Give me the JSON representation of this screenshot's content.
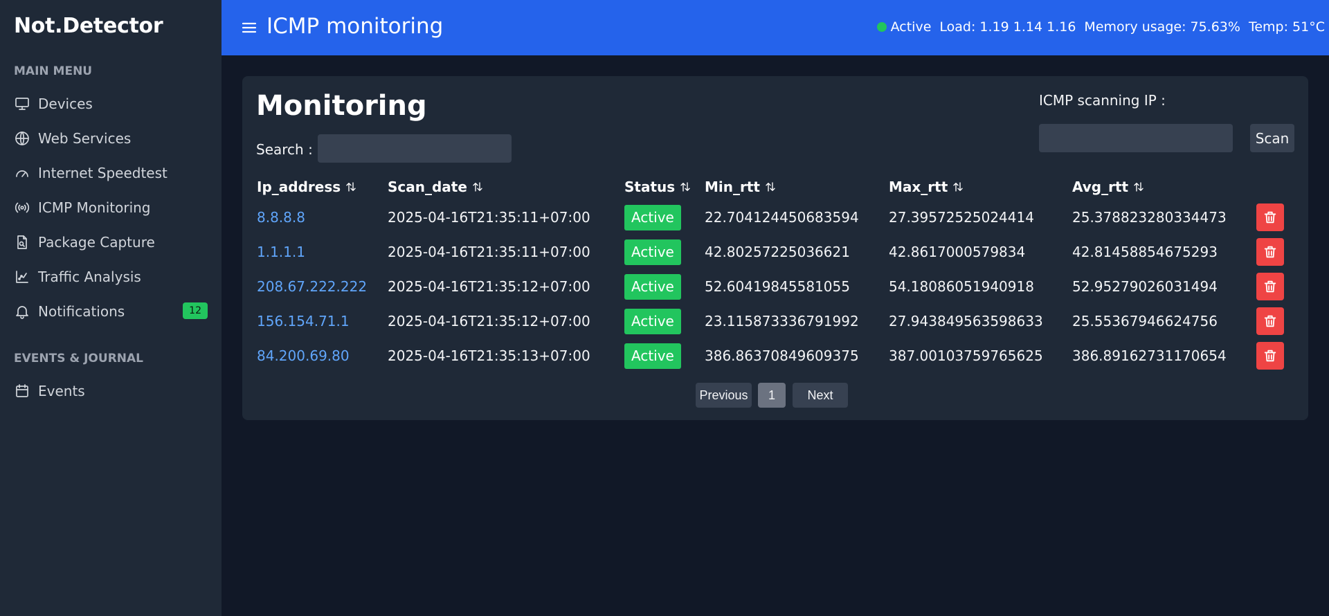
{
  "app": {
    "brand": "Not.Detector",
    "page_header": "ICMP monitoring"
  },
  "system_status": {
    "state": "Active",
    "load": "Load: 1.19 1.14 1.16",
    "memory": "Memory usage: 75.63%",
    "temp": "Temp: 51°C"
  },
  "sidebar": {
    "main_menu_title": "MAIN MENU",
    "events_title": "EVENTS & JOURNAL",
    "items": [
      {
        "label": "Devices",
        "icon": "monitor-icon"
      },
      {
        "label": "Web Services",
        "icon": "globe-icon"
      },
      {
        "label": "Internet Speedtest",
        "icon": "gauge-icon"
      },
      {
        "label": "ICMP Monitoring",
        "icon": "broadcast-icon"
      },
      {
        "label": "Package Capture",
        "icon": "file-search-icon"
      },
      {
        "label": "Traffic Analysis",
        "icon": "chart-icon"
      },
      {
        "label": "Notifications",
        "icon": "bell-icon",
        "badge": "12"
      }
    ],
    "events_items": [
      {
        "label": "Events",
        "icon": "calendar-icon"
      }
    ]
  },
  "monitoring": {
    "title": "Monitoring",
    "search_label": "Search :",
    "search_value": "",
    "scan_label": "ICMP scanning IP :",
    "scan_value": "",
    "scan_button": "Scan",
    "columns": [
      "Ip_address",
      "Scan_date",
      "Status",
      "Min_rtt",
      "Max_rtt",
      "Avg_rtt"
    ],
    "rows": [
      {
        "ip": "8.8.8.8",
        "scan_date": "2025-04-16T21:35:11+07:00",
        "status": "Active",
        "min_rtt": "22.704124450683594",
        "max_rtt": "27.39572525024414",
        "avg_rtt": "25.378823280334473"
      },
      {
        "ip": "1.1.1.1",
        "scan_date": "2025-04-16T21:35:11+07:00",
        "status": "Active",
        "min_rtt": "42.80257225036621",
        "max_rtt": "42.8617000579834",
        "avg_rtt": "42.81458854675293"
      },
      {
        "ip": "208.67.222.222",
        "scan_date": "2025-04-16T21:35:12+07:00",
        "status": "Active",
        "min_rtt": "52.60419845581055",
        "max_rtt": "54.18086051940918",
        "avg_rtt": "52.95279026031494"
      },
      {
        "ip": "156.154.71.1",
        "scan_date": "2025-04-16T21:35:12+07:00",
        "status": "Active",
        "min_rtt": "23.115873336791992",
        "max_rtt": "27.943849563598633",
        "avg_rtt": "25.55367946624756"
      },
      {
        "ip": "84.200.69.80",
        "scan_date": "2025-04-16T21:35:13+07:00",
        "status": "Active",
        "min_rtt": "386.86370849609375",
        "max_rtt": "387.00103759765625",
        "avg_rtt": "386.89162731170654"
      }
    ],
    "pagination": {
      "previous": "Previous",
      "current": "1",
      "next": "Next"
    }
  },
  "colors": {
    "accent": "#2563eb",
    "sidebar_bg": "#1f2937",
    "page_bg": "#111827",
    "active": "#22c55e",
    "danger": "#ef4444",
    "link": "#60a5fa"
  }
}
